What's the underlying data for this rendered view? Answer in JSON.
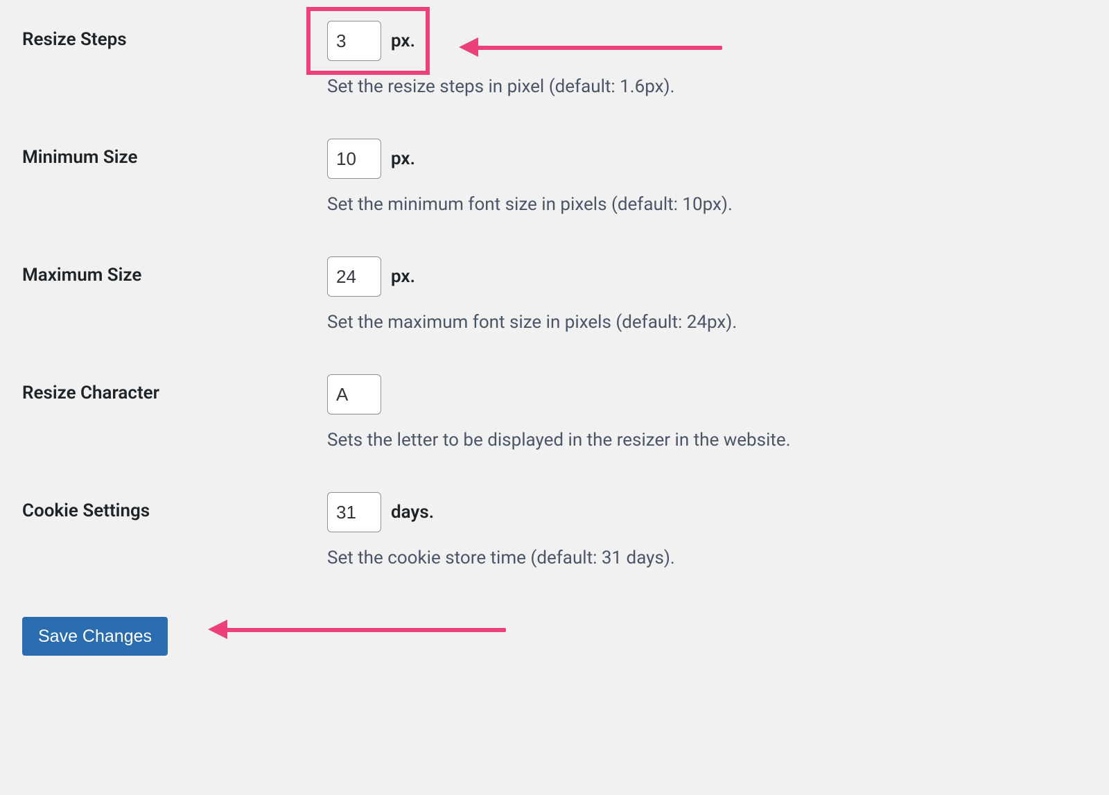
{
  "fields": {
    "resize_steps": {
      "label": "Resize Steps",
      "value": "3",
      "unit": "px.",
      "description": "Set the resize steps in pixel (default: 1.6px)."
    },
    "minimum_size": {
      "label": "Minimum Size",
      "value": "10",
      "unit": "px.",
      "description": "Set the minimum font size in pixels (default: 10px)."
    },
    "maximum_size": {
      "label": "Maximum Size",
      "value": "24",
      "unit": "px.",
      "description": "Set the maximum font size in pixels (default: 24px)."
    },
    "resize_character": {
      "label": "Resize Character",
      "value": "A",
      "unit": "",
      "description": "Sets the letter to be displayed in the resizer in the website."
    },
    "cookie_settings": {
      "label": "Cookie Settings",
      "value": "31",
      "unit": "days.",
      "description": "Set the cookie store time (default: 31 days)."
    }
  },
  "submit": {
    "label": "Save Changes"
  },
  "annotations": {
    "highlight_color": "#ec407a"
  }
}
